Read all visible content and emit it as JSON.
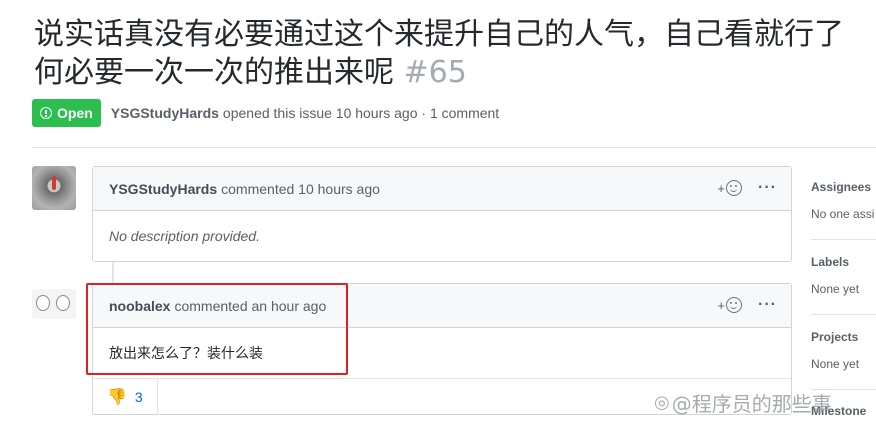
{
  "issue": {
    "title": "说实话真没有必要通过这个来提升自己的人气，自己看就行了何必要一次一次的推出来呢",
    "number": "#65",
    "state": "Open",
    "author": "YSGStudyHards",
    "meta_text": "opened this issue 10 hours ago · 1 comment"
  },
  "comments": [
    {
      "author": "YSGStudyHards",
      "action": "commented 10 hours ago",
      "body": "No description provided.",
      "add_reaction": "+",
      "menu": "···"
    },
    {
      "author": "noobalex",
      "action": "commented an hour ago",
      "body": "放出来怎么了？装什么装",
      "add_reaction": "+",
      "menu": "···",
      "reaction": {
        "emoji": "👎",
        "count": "3"
      }
    }
  ],
  "sidebar": {
    "assignees": {
      "heading": "Assignees",
      "value": "No one assi"
    },
    "labels": {
      "heading": "Labels",
      "value": "None yet"
    },
    "projects": {
      "heading": "Projects",
      "value": "None yet"
    },
    "milestone": {
      "heading": "Milestone"
    }
  },
  "watermark": {
    "text": "@程序员的那些事"
  },
  "colors": {
    "open_badge": "#2cbe4e",
    "highlight": "#e02020",
    "link": "#0366d6"
  }
}
